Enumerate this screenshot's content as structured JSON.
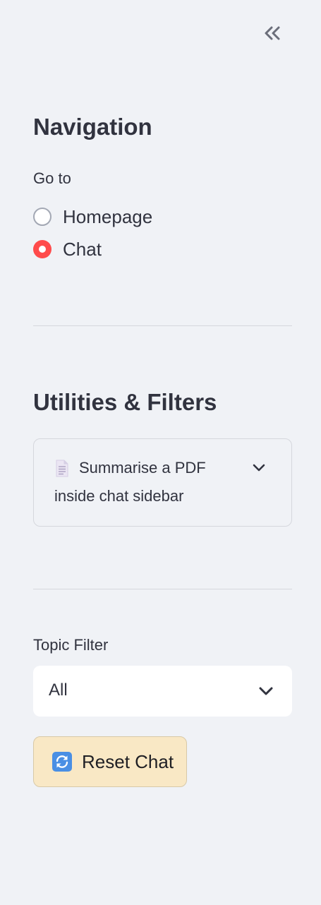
{
  "sidebar": {
    "collapse_icon": "double-chevron-left-icon",
    "navigation": {
      "title": "Navigation",
      "radio_label": "Go to",
      "options": [
        {
          "label": "Homepage",
          "selected": false
        },
        {
          "label": "Chat",
          "selected": true
        }
      ]
    },
    "utilities": {
      "title": "Utilities & Filters",
      "expander": {
        "icon": "document-icon",
        "line1": "Summarise a PDF",
        "line2": "inside chat sidebar",
        "chevron_icon": "chevron-down-icon"
      }
    },
    "topic_filter": {
      "label": "Topic Filter",
      "value": "All",
      "chevron_icon": "chevron-down-icon"
    },
    "reset_button": {
      "icon": "refresh-icon",
      "label": "Reset Chat"
    }
  },
  "colors": {
    "background": "#f0f2f6",
    "text": "#31333f",
    "accent": "#ff4b4b",
    "reset_button_bg": "#f9e8c5",
    "reset_icon_bg": "#4a8fe4"
  }
}
